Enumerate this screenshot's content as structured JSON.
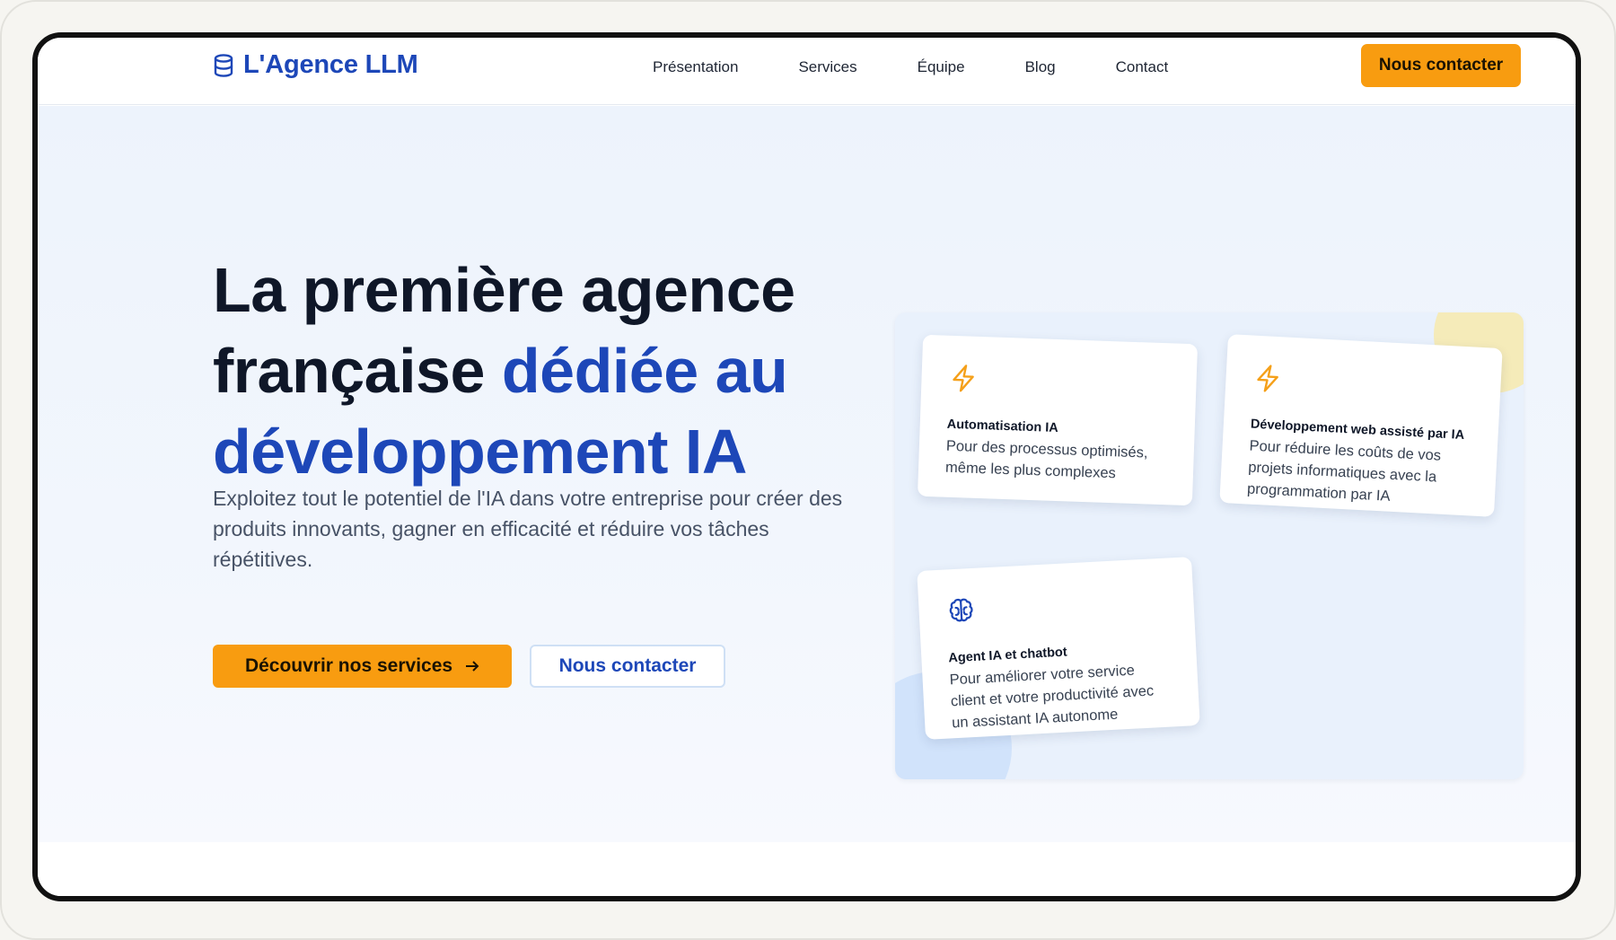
{
  "brand": {
    "name": "L'Agence LLM",
    "icon": "database-icon",
    "color": "#1d47b8"
  },
  "nav": {
    "items": [
      {
        "label": "Présentation"
      },
      {
        "label": "Services"
      },
      {
        "label": "Équipe"
      },
      {
        "label": "Blog"
      },
      {
        "label": "Contact"
      }
    ],
    "cta_label": "Nous contacter"
  },
  "hero": {
    "title_line_1": "La première agence",
    "title_line_2_plain": "française ",
    "title_line_2_accent": "dédiée au",
    "title_line_3_accent": "développement IA",
    "subtitle": "Exploitez tout le potentiel de l'IA dans votre entreprise pour créer des produits innovants, gagner en efficacité et réduire vos tâches répétitives.",
    "primary_button": "Découvrir nos services",
    "primary_button_icon": "arrow-right-icon",
    "secondary_button": "Nous contacter"
  },
  "cards": [
    {
      "icon": "lightning-icon",
      "title": "Automatisation IA",
      "description": "Pour des processus optimisés, même les plus complexes"
    },
    {
      "icon": "lightning-icon",
      "title": "Développement web assisté par IA",
      "description": "Pour réduire les coûts de vos projets informatiques avec la programmation par IA"
    },
    {
      "icon": "brain-icon",
      "title": "Agent IA et chatbot",
      "description": "Pour améliorer votre service client et votre productivité avec un assistant IA autonome"
    }
  ],
  "colors": {
    "accent": "#1d47b8",
    "cta": "#f89c10",
    "icon_orange": "#f5a019",
    "icon_blue": "#1d47b8"
  }
}
